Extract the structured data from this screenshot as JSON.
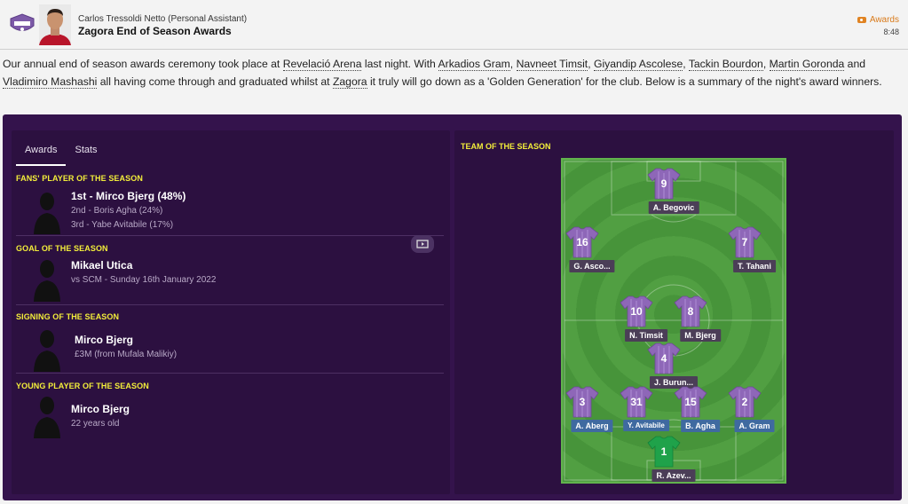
{
  "header": {
    "sender": "Carlos Tressoldi Netto  (Personal Assistant)",
    "subject": "Zagora End of Season Awards",
    "tag": "Awards",
    "time": "8:48"
  },
  "body": {
    "t1": "Our annual end of season awards ceremony took place at ",
    "venue": "Revelació Arena",
    "t2": " last night. With ",
    "p1": "Arkadios Gram",
    "s1": ", ",
    "p2": "Navneet Timsit",
    "s2": ", ",
    "p3": "Giyandip Ascolese",
    "s3": ", ",
    "p4": "Tackin Bourdon",
    "s4": ", ",
    "p5": "Martin Goronda",
    "s5": " and ",
    "p6": "Vladimiro Mashashi",
    "t3": " all having come through and graduated whilst at ",
    "club": "Zagora",
    "t4": " it truly will go down as a 'Golden Generation' for the club. Below is a summary of the night's award winners."
  },
  "tabs": {
    "awards": "Awards",
    "stats": "Stats"
  },
  "awards": {
    "fans": {
      "heading": "FANS' PLAYER OF THE SEASON",
      "first": "1st - Mirco Bjerg (48%)",
      "second": "2nd - Boris Agha (24%)",
      "third": "3rd - Yabe Avitabile (17%)"
    },
    "goal": {
      "heading": "GOAL OF THE SEASON",
      "name": "Mikael Utica",
      "detail": "vs SCM - Sunday 16th January 2022"
    },
    "signing": {
      "heading": "SIGNING OF THE SEASON",
      "name": "Mirco Bjerg",
      "detail": "£3M (from Mufala Malikiy)"
    },
    "young": {
      "heading": "YOUNG PLAYER OF THE SEASON",
      "name": "Mirco Bjerg",
      "detail": "22 years old"
    }
  },
  "team": {
    "heading": "TEAM OF THE SEASON",
    "players": [
      {
        "number": "9",
        "name": "A. Begovic"
      },
      {
        "number": "16",
        "name": "G. Asco..."
      },
      {
        "number": "7",
        "name": "T. Tahani"
      },
      {
        "number": "10",
        "name": "N. Timsit"
      },
      {
        "number": "8",
        "name": "M. Bjerg"
      },
      {
        "number": "4",
        "name": "J. Burun..."
      },
      {
        "number": "3",
        "name": "A. Aberg"
      },
      {
        "number": "31",
        "name": "Y. Avitabile"
      },
      {
        "number": "15",
        "name": "B. Agha"
      },
      {
        "number": "2",
        "name": "A. Gram"
      },
      {
        "number": "1",
        "name": "R. Azev..."
      }
    ]
  },
  "colors": {
    "panel": "#34134c",
    "card": "#2c1040",
    "heading": "#f3ee3a",
    "shirt": "#8e67b8",
    "keeper": "#1fa24a",
    "defender_label": "#3f6aa0"
  },
  "icons": {
    "tag": "tag-icon",
    "video": "video-highlight-icon"
  }
}
